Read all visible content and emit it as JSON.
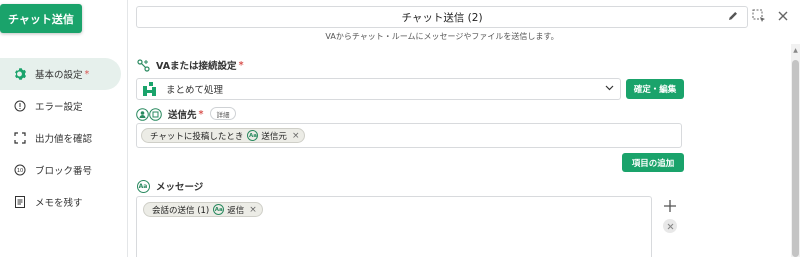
{
  "app_badge": "チャット送信",
  "nav": [
    {
      "label": "基本の設定",
      "icon": "gear-icon",
      "required": "*"
    },
    {
      "label": "エラー設定",
      "icon": "error-info-icon"
    },
    {
      "label": "出力値を確認",
      "icon": "output-frame-icon"
    },
    {
      "label": "ブロック番号",
      "icon": "block-number-icon"
    },
    {
      "label": "メモを残す",
      "icon": "memo-icon"
    }
  ],
  "header": {
    "title": "チャット送信 (2)",
    "subtitle": "VAからチャット・ルームにメッセージやファイルを送信します。"
  },
  "va_section": {
    "label": "VAまたは接続設定",
    "required": "*",
    "selected": "まとめて処理",
    "confirm_button": "確定・編集"
  },
  "recipient_section": {
    "label": "送信先",
    "required": "*",
    "detail_pill": "詳細",
    "chip_text": "チャットに投稿したとき",
    "chip_icon_text": "Aa",
    "chip_suffix": "送信元",
    "add_item_button": "項目の追加"
  },
  "message_section": {
    "label": "メッセージ",
    "icon_text": "Aa",
    "chip_text": "会話の送信 (1)",
    "chip_icon_text": "Aa",
    "chip_suffix": "返信"
  },
  "colors": {
    "accent": "#1aa36b",
    "nav_active_bg": "#e6f0ec",
    "required": "#d9534f"
  }
}
